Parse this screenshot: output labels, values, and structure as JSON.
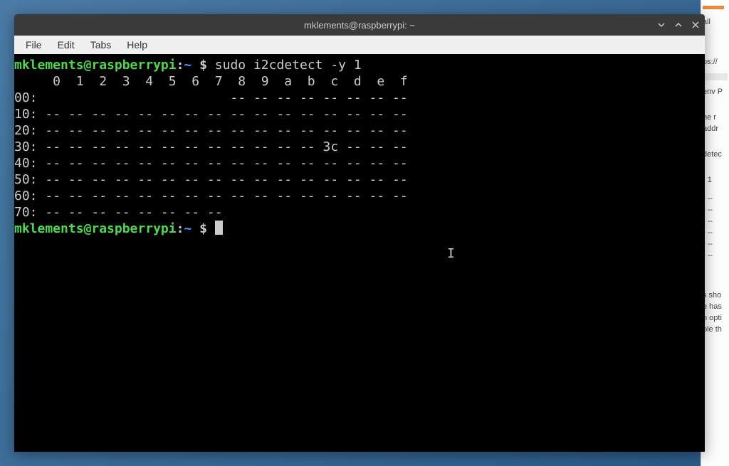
{
  "window": {
    "title": "mklements@raspberrypi: ~"
  },
  "menubar": {
    "items": [
      "File",
      "Edit",
      "Tabs",
      "Help"
    ]
  },
  "terminal": {
    "prompt": {
      "user_host": "mklements@raspberrypi",
      "colon": ":",
      "path": "~",
      "dollar": " $ "
    },
    "command": "sudo i2cdetect -y 1",
    "output": {
      "header": "     0  1  2  3  4  5  6  7  8  9  a  b  c  d  e  f",
      "rows": [
        "00:                         -- -- -- -- -- -- -- --",
        "10: -- -- -- -- -- -- -- -- -- -- -- -- -- -- -- --",
        "20: -- -- -- -- -- -- -- -- -- -- -- -- -- -- -- --",
        "30: -- -- -- -- -- -- -- -- -- -- -- -- 3c -- -- --",
        "40: -- -- -- -- -- -- -- -- -- -- -- -- -- -- -- --",
        "50: -- -- -- -- -- -- -- -- -- -- -- -- -- -- -- --",
        "60: -- -- -- -- -- -- -- -- -- -- -- -- -- -- -- --",
        "70: -- -- -- -- -- -- -- --"
      ]
    }
  },
  "side_panel": {
    "fragments": [
      "all",
      "ps://",
      "env P",
      "he r",
      "addr",
      "detec",
      ") 1",
      "- --",
      "- --",
      "- --",
      "- --",
      "- --",
      "- --",
      "s sho",
      "e has",
      "n opti",
      "ble th"
    ]
  }
}
